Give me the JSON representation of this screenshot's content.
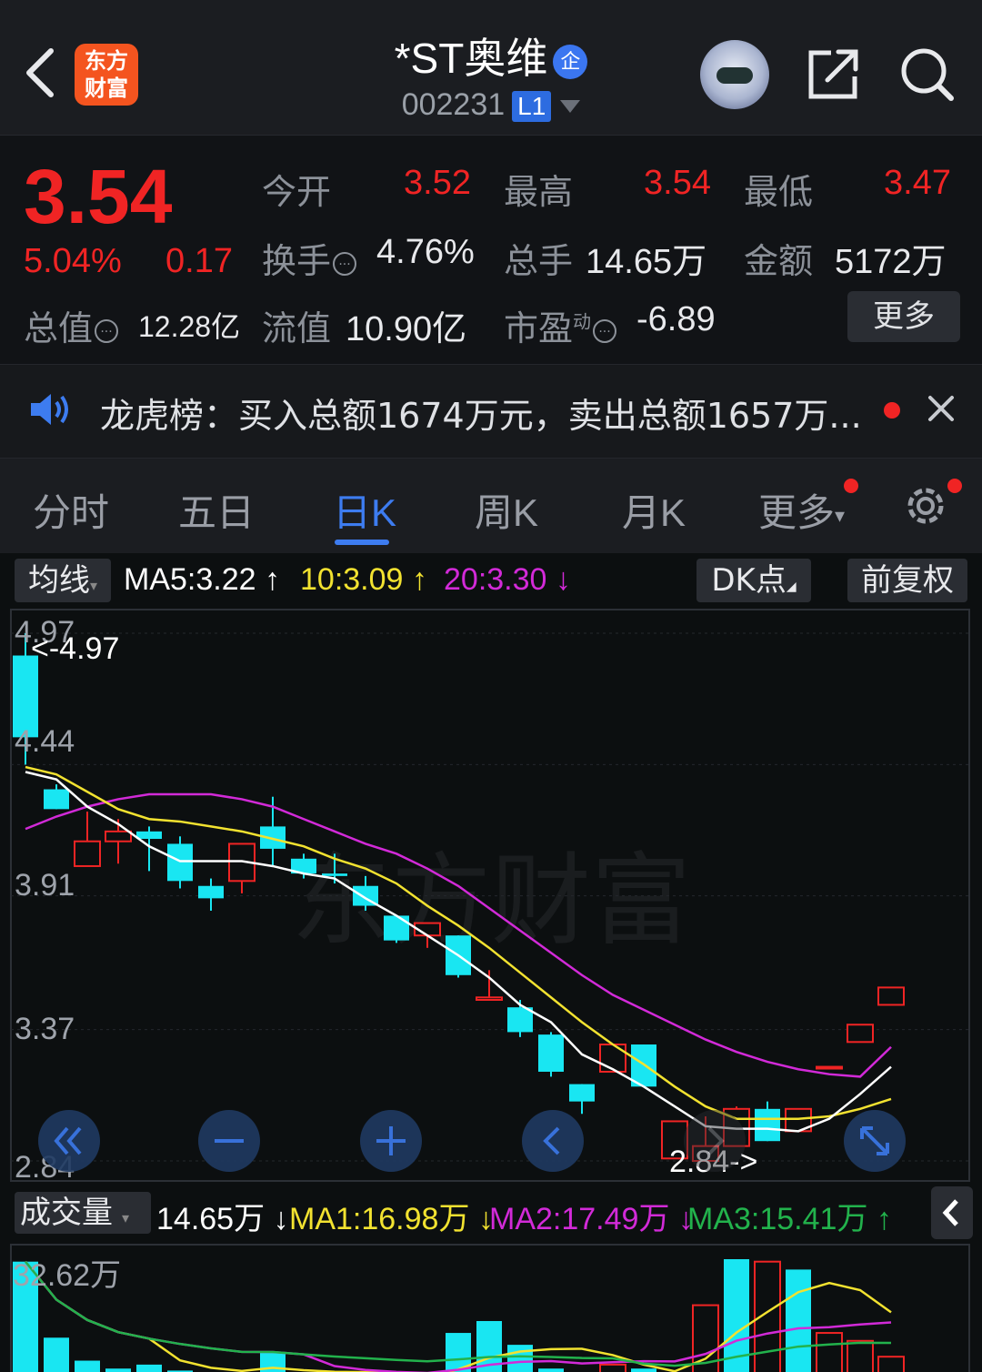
{
  "header": {
    "title": "*ST奥维",
    "title_badge": "企",
    "code": "002231",
    "level": "L1",
    "logo_text_1": "东方",
    "logo_text_2": "财富"
  },
  "quote": {
    "price": "3.54",
    "change_pct": "5.04%",
    "change": "0.17",
    "open_label": "今开",
    "open": "3.52",
    "high_label": "最高",
    "high": "3.54",
    "low_label": "最低",
    "low": "3.47",
    "turnover_label": "换手",
    "turnover": "4.76%",
    "volume_label": "总手",
    "volume": "14.65万",
    "amount_label": "金额",
    "amount": "5172万",
    "mktcap_label": "总值",
    "mktcap": "12.28亿",
    "float_label": "流值",
    "float_cap": "10.90亿",
    "pe_label": "市盈",
    "pe_sup": "动",
    "pe": "-6.89",
    "more": "更多"
  },
  "notice": {
    "text": "龙虎榜：买入总额1674万元，卖出总额1657万..."
  },
  "tabs": [
    "分时",
    "五日",
    "日K",
    "周K",
    "月K",
    "更多"
  ],
  "active_tab": "日K",
  "chart_header": {
    "ma_type": "均线",
    "ma5": "MA5:3.22",
    "ma10": "10:3.09",
    "ma20": "20:3.30",
    "dk": "DK点",
    "adjust": "前复权"
  },
  "volume_header": {
    "label": "成交量",
    "vol": "14.65万",
    "ma1": "MA1:16.98万",
    "ma2": "MA2:17.49万",
    "ma3": "MA3:15.41万",
    "top": "32.62万"
  },
  "colors": {
    "up": "#f02424",
    "down": "#19e6f2",
    "ma5": "#ffffff",
    "ma10": "#f2e230",
    "ma20": "#d22ad8",
    "ma3_vol": "#22b24c",
    "accent": "#3d7cf0"
  },
  "chart_data": {
    "type": "candlestick",
    "y_ticks": [
      "4.97",
      "4.44",
      "3.91",
      "3.37",
      "2.84"
    ],
    "ylim": [
      2.84,
      4.97
    ],
    "max_label": "<-4.97",
    "min_label": "2.84->",
    "candles": [
      {
        "o": 4.88,
        "h": 4.97,
        "l": 4.44,
        "c": 4.55
      },
      {
        "o": 4.34,
        "h": 4.36,
        "l": 4.26,
        "c": 4.26
      },
      {
        "o": 4.03,
        "h": 4.25,
        "l": 4.03,
        "c": 4.13
      },
      {
        "o": 4.13,
        "h": 4.22,
        "l": 4.04,
        "c": 4.17
      },
      {
        "o": 4.17,
        "h": 4.19,
        "l": 4.01,
        "c": 4.14
      },
      {
        "o": 4.12,
        "h": 4.15,
        "l": 3.94,
        "c": 3.97
      },
      {
        "o": 3.95,
        "h": 3.98,
        "l": 3.85,
        "c": 3.9
      },
      {
        "o": 3.97,
        "h": 4.12,
        "l": 3.92,
        "c": 4.12
      },
      {
        "o": 4.19,
        "h": 4.31,
        "l": 4.03,
        "c": 4.1
      },
      {
        "o": 4.06,
        "h": 4.08,
        "l": 3.98,
        "c": 4.0
      },
      {
        "o": 4.0,
        "h": 4.08,
        "l": 3.96,
        "c": 3.99
      },
      {
        "o": 3.95,
        "h": 3.99,
        "l": 3.85,
        "c": 3.87
      },
      {
        "o": 3.83,
        "h": 3.83,
        "l": 3.72,
        "c": 3.73
      },
      {
        "o": 3.75,
        "h": 3.8,
        "l": 3.7,
        "c": 3.8
      },
      {
        "o": 3.75,
        "h": 3.75,
        "l": 3.58,
        "c": 3.59
      },
      {
        "o": 3.49,
        "h": 3.61,
        "l": 3.49,
        "c": 3.5
      },
      {
        "o": 3.46,
        "h": 3.49,
        "l": 3.34,
        "c": 3.36
      },
      {
        "o": 3.35,
        "h": 3.36,
        "l": 3.18,
        "c": 3.2
      },
      {
        "o": 3.15,
        "h": 3.15,
        "l": 3.03,
        "c": 3.08
      },
      {
        "o": 3.2,
        "h": 3.2,
        "l": 3.2,
        "c": 3.31
      },
      {
        "o": 3.31,
        "h": 3.31,
        "l": 3.14,
        "c": 3.14
      },
      {
        "o": 2.85,
        "h": 2.85,
        "l": 2.85,
        "c": 3.0
      },
      {
        "o": 2.84,
        "h": 3.02,
        "l": 2.84,
        "c": 2.9
      },
      {
        "o": 2.9,
        "h": 3.06,
        "l": 2.9,
        "c": 3.05
      },
      {
        "o": 3.05,
        "h": 3.08,
        "l": 2.92,
        "c": 2.92
      },
      {
        "o": 2.96,
        "h": 3.05,
        "l": 2.96,
        "c": 3.05
      },
      {
        "o": 3.22,
        "h": 3.22,
        "l": 3.22,
        "c": 3.22
      },
      {
        "o": 3.32,
        "h": 3.32,
        "l": 3.32,
        "c": 3.39
      },
      {
        "o": 3.47,
        "h": 3.54,
        "l": 3.47,
        "c": 3.54
      }
    ],
    "ma5": [
      4.41,
      4.38,
      4.27,
      4.2,
      4.11,
      4.05,
      4.05,
      4.05,
      4.03,
      4.0,
      3.98,
      3.9,
      3.83,
      3.75,
      3.67,
      3.58,
      3.47,
      3.4,
      3.27,
      3.21,
      3.14,
      3.06,
      2.98,
      2.97,
      2.97,
      2.96,
      3.01,
      3.11,
      3.22
    ],
    "ma10": [
      4.43,
      4.4,
      4.33,
      4.26,
      4.22,
      4.21,
      4.19,
      4.17,
      4.14,
      4.11,
      4.06,
      4.02,
      3.96,
      3.87,
      3.79,
      3.7,
      3.6,
      3.5,
      3.4,
      3.31,
      3.23,
      3.14,
      3.06,
      3.01,
      3.01,
      3.01,
      3.02,
      3.05,
      3.09
    ],
    "ma20": [
      4.18,
      4.23,
      4.27,
      4.3,
      4.32,
      4.32,
      4.32,
      4.3,
      4.27,
      4.22,
      4.17,
      4.12,
      4.08,
      4.02,
      3.95,
      3.86,
      3.77,
      3.68,
      3.59,
      3.51,
      3.45,
      3.39,
      3.33,
      3.28,
      3.24,
      3.21,
      3.19,
      3.18,
      3.3
    ]
  },
  "volume_data": {
    "ylim": [
      0,
      32.62
    ],
    "bars": [
      {
        "v": 32.0,
        "up": false
      },
      {
        "v": 12.8,
        "up": false
      },
      {
        "v": 7.0,
        "up": false
      },
      {
        "v": 5.0,
        "up": false
      },
      {
        "v": 6.0,
        "up": false
      },
      {
        "v": 4.5,
        "up": false
      },
      {
        "v": 3.5,
        "up": false
      },
      {
        "v": 3.0,
        "up": true
      },
      {
        "v": 9.0,
        "up": false
      },
      {
        "v": 3.0,
        "up": false
      },
      {
        "v": 2.5,
        "up": false
      },
      {
        "v": 3.0,
        "up": false
      },
      {
        "v": 2.0,
        "up": false
      },
      {
        "v": 2.5,
        "up": true
      },
      {
        "v": 14.0,
        "up": false
      },
      {
        "v": 17.0,
        "up": false
      },
      {
        "v": 11.0,
        "up": false
      },
      {
        "v": 5.0,
        "up": false
      },
      {
        "v": 3.0,
        "up": false
      },
      {
        "v": 6.0,
        "up": true
      },
      {
        "v": 5.0,
        "up": false
      },
      {
        "v": 2.5,
        "up": true
      },
      {
        "v": 21.0,
        "up": true
      },
      {
        "v": 36.0,
        "up": false
      },
      {
        "v": 32.0,
        "up": true
      },
      {
        "v": 30.0,
        "up": false
      },
      {
        "v": 14.0,
        "up": true
      },
      {
        "v": 12.0,
        "up": true
      },
      {
        "v": 8.0,
        "up": true
      }
    ]
  }
}
